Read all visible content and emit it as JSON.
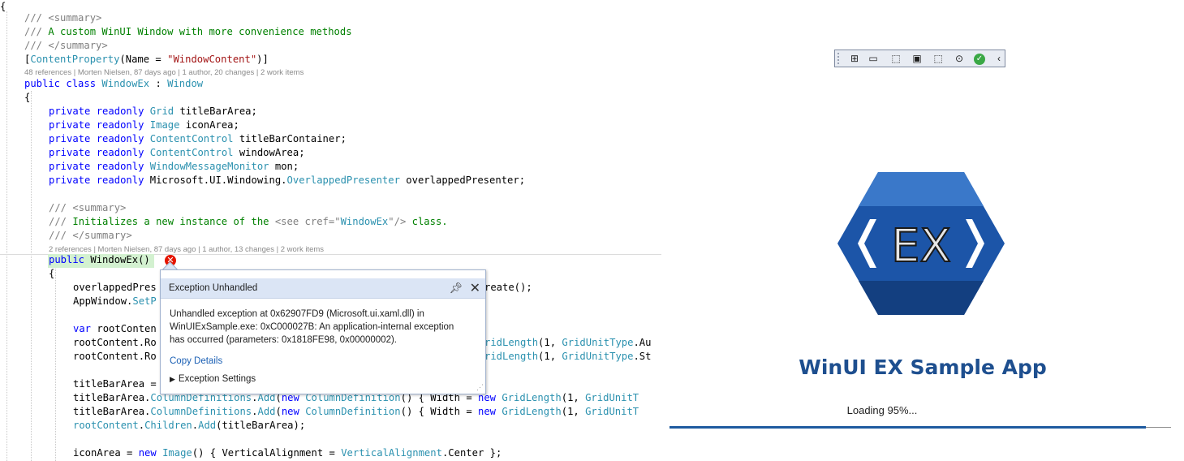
{
  "editor": {
    "lines": [
      {
        "segs": [
          [
            "",
            "{"
          ]
        ]
      },
      {
        "segs": [
          [
            "dc",
            "/// "
          ],
          [
            "dc",
            "<summary>"
          ]
        ]
      },
      {
        "segs": [
          [
            "dc",
            "/// "
          ],
          [
            "cm",
            "A custom WinUI Window with more convenience methods"
          ]
        ]
      },
      {
        "segs": [
          [
            "dc",
            "/// "
          ],
          [
            "dc",
            "</summary>"
          ]
        ]
      },
      {
        "segs": [
          [
            "",
            "["
          ],
          [
            "ty",
            "ContentProperty"
          ],
          [
            "",
            "(Name = "
          ],
          [
            "st",
            "\"WindowContent\""
          ],
          [
            "",
            ")]"
          ]
        ]
      },
      {
        "segs": [
          [
            "kw",
            "public"
          ],
          [
            "",
            " "
          ],
          [
            "kw",
            "class"
          ],
          [
            "",
            " "
          ],
          [
            "ty",
            "WindowEx"
          ],
          [
            "",
            " : "
          ],
          [
            "ty",
            "Window"
          ]
        ]
      },
      {
        "segs": [
          [
            "",
            "{"
          ]
        ]
      },
      {
        "segs": [
          [
            "kw",
            "private"
          ],
          [
            "",
            " "
          ],
          [
            "kw",
            "readonly"
          ],
          [
            "",
            " "
          ],
          [
            "ty",
            "Grid"
          ],
          [
            "",
            " titleBarArea;"
          ]
        ]
      },
      {
        "segs": [
          [
            "kw",
            "private"
          ],
          [
            "",
            " "
          ],
          [
            "kw",
            "readonly"
          ],
          [
            "",
            " "
          ],
          [
            "ty",
            "Image"
          ],
          [
            "",
            " iconArea;"
          ]
        ]
      },
      {
        "segs": [
          [
            "kw",
            "private"
          ],
          [
            "",
            " "
          ],
          [
            "kw",
            "readonly"
          ],
          [
            "",
            " "
          ],
          [
            "ty",
            "ContentControl"
          ],
          [
            "",
            " titleBarContainer;"
          ]
        ]
      },
      {
        "segs": [
          [
            "kw",
            "private"
          ],
          [
            "",
            " "
          ],
          [
            "kw",
            "readonly"
          ],
          [
            "",
            " "
          ],
          [
            "ty",
            "ContentControl"
          ],
          [
            "",
            " windowArea;"
          ]
        ]
      },
      {
        "segs": [
          [
            "kw",
            "private"
          ],
          [
            "",
            " "
          ],
          [
            "kw",
            "readonly"
          ],
          [
            "",
            " "
          ],
          [
            "ty",
            "WindowMessageMonitor"
          ],
          [
            "",
            " mon;"
          ]
        ]
      },
      {
        "segs": [
          [
            "kw",
            "private"
          ],
          [
            "",
            " "
          ],
          [
            "kw",
            "readonly"
          ],
          [
            "",
            " Microsoft.UI.Windowing."
          ],
          [
            "ty",
            "OverlappedPresenter"
          ],
          [
            "",
            " overlappedPresenter;"
          ]
        ]
      },
      {
        "segs": [
          [
            "dc",
            "/// "
          ],
          [
            "dc",
            "<summary>"
          ]
        ]
      },
      {
        "segs": [
          [
            "dc",
            "/// "
          ],
          [
            "cm",
            "Initializes a new instance of the "
          ],
          [
            "dc",
            "<see cref=\""
          ],
          [
            "ty",
            "WindowEx"
          ],
          [
            "dc",
            "\"/>"
          ],
          [
            "cm",
            " class."
          ]
        ]
      },
      {
        "segs": [
          [
            "dc",
            "/// "
          ],
          [
            "dc",
            "</summary>"
          ]
        ]
      },
      {
        "segs": [
          [
            "kw",
            "public"
          ],
          [
            "",
            " WindowEx()"
          ]
        ]
      },
      {
        "segs": [
          [
            "",
            "{"
          ]
        ]
      },
      {
        "segs": [
          [
            "",
            "overlappedPres"
          ]
        ]
      },
      {
        "segs": [
          [
            "",
            "AppWindow."
          ],
          [
            "ty",
            "SetP"
          ]
        ]
      },
      {
        "segs": [
          [
            "kw",
            "var"
          ],
          [
            "",
            " rootConten"
          ]
        ]
      },
      {
        "segs": [
          [
            "",
            "rootContent.Ro"
          ]
        ]
      },
      {
        "segs": [
          [
            "",
            "rootContent.Ro"
          ]
        ]
      },
      {
        "segs": [
          [
            "",
            "titleBarArea ="
          ]
        ]
      },
      {
        "segs": [
          [
            "",
            "titleBarArea."
          ],
          [
            "ty",
            "ColumnDefinitions"
          ],
          [
            "",
            "."
          ],
          [
            "ty",
            "Add"
          ],
          [
            "",
            "("
          ],
          [
            "kw",
            "new"
          ],
          [
            "",
            " "
          ],
          [
            "ty",
            "ColumnDefinition"
          ],
          [
            "",
            "() { Width = "
          ],
          [
            "kw",
            "new"
          ],
          [
            "",
            " "
          ],
          [
            "ty",
            "GridLength"
          ],
          [
            "",
            "(1, "
          ],
          [
            "ty",
            "GridUnitT"
          ]
        ]
      },
      {
        "segs": [
          [
            "",
            "titleBarArea."
          ],
          [
            "ty",
            "ColumnDefinitions"
          ],
          [
            "",
            "."
          ],
          [
            "ty",
            "Add"
          ],
          [
            "",
            "("
          ],
          [
            "kw",
            "new"
          ],
          [
            "",
            " "
          ],
          [
            "ty",
            "ColumnDefinition"
          ],
          [
            "",
            "() { Width = "
          ],
          [
            "kw",
            "new"
          ],
          [
            "",
            " "
          ],
          [
            "ty",
            "GridLength"
          ],
          [
            "",
            "(1, "
          ],
          [
            "ty",
            "GridUnitT"
          ]
        ]
      },
      {
        "segs": [
          [
            "ty",
            "rootContent"
          ],
          [
            "",
            "."
          ],
          [
            "ty",
            "Children"
          ],
          [
            "",
            "."
          ],
          [
            "ty",
            "Add"
          ],
          [
            "",
            "(titleBarArea);"
          ]
        ]
      },
      {
        "segs": [
          [
            "",
            "iconArea = "
          ],
          [
            "kw",
            "new"
          ],
          [
            "",
            " "
          ],
          [
            "ty",
            "Image"
          ],
          [
            "",
            "() { VerticalAlignment = "
          ],
          [
            "ty",
            "VerticalAlignment"
          ],
          [
            "",
            ".Center };"
          ]
        ]
      }
    ],
    "code_fragments": [
      {
        "segs": [
          [
            "",
            "reate();"
          ]
        ]
      },
      {
        "segs": [
          [
            "ty",
            "ridLength"
          ],
          [
            "",
            "(1, "
          ],
          [
            "ty",
            "GridUnitType"
          ],
          [
            "",
            ".Au"
          ]
        ]
      },
      {
        "segs": [
          [
            "ty",
            "ridLength"
          ],
          [
            "",
            "(1, "
          ],
          [
            "ty",
            "GridUnitType"
          ],
          [
            "",
            ".St"
          ]
        ]
      }
    ],
    "lens": [
      "48 references | Morten Nielsen, 87 days ago | 1 author, 20 changes | 2 work items",
      "2 references | Morten Nielsen, 87 days ago | 1 author, 13 changes | 2 work items"
    ]
  },
  "exception_popup": {
    "title": "Exception Unhandled",
    "pin_icon": "pin-icon",
    "close_icon": "close-icon",
    "message": "Unhandled exception at 0x62907FD9 (Microsoft.ui.xaml.dll) in WinUIExSample.exe: 0xC000027B: An application-internal exception has occurred (parameters: 0x1818FE98, 0x00000002).",
    "copy_details": "Copy Details",
    "settings": "Exception Settings",
    "expand_icon": "triangle-right-icon"
  },
  "debug_toolbar": {
    "buttons": [
      {
        "name": "live-visual-tree-icon",
        "glyph": "⊞"
      },
      {
        "name": "record-icon",
        "glyph": "▭"
      },
      {
        "name": "select-element-icon",
        "glyph": "⬚"
      },
      {
        "name": "display-layout-adorners-icon",
        "glyph": "▣"
      },
      {
        "name": "track-focus-icon",
        "glyph": "⬚"
      },
      {
        "name": "binding-failures-icon",
        "glyph": "⊙"
      },
      {
        "name": "accessibility-checker-icon",
        "glyph": "✓"
      },
      {
        "name": "collapse-toolbar-icon",
        "glyph": "‹"
      }
    ]
  },
  "app": {
    "logo_text": "EX",
    "title": "WinUI EX Sample App",
    "loading_text": "Loading 95%...",
    "progress": 0.95,
    "accent_color": "#1e5aa0",
    "error_color": "#e51400"
  }
}
